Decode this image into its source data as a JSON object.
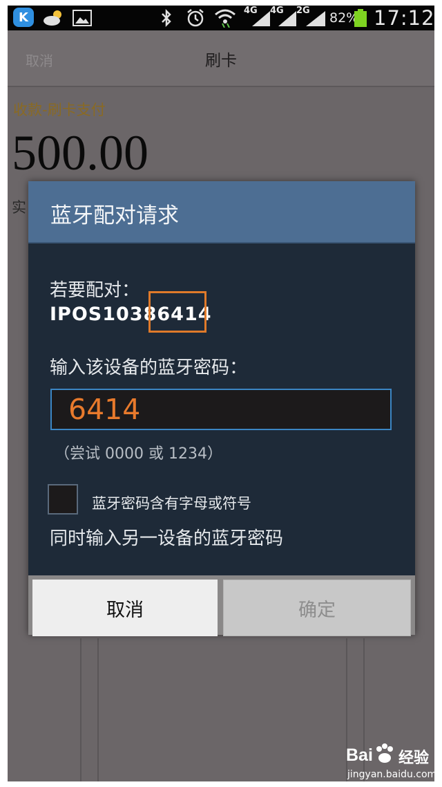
{
  "status_bar": {
    "app_icon_letter": "K",
    "net1": "4G",
    "net2": "4G",
    "net3": "2G",
    "battery_percent": "82%",
    "time": "17:12",
    "icons": [
      "app-k-icon",
      "weather-icon",
      "gallery-icon",
      "bluetooth-icon",
      "alarm-icon",
      "wifi-icon",
      "signal-4g-icon",
      "signal-4g-icon",
      "signal-2g-icon",
      "battery-icon"
    ]
  },
  "background_app": {
    "cancel_label": "取消",
    "title": "刷卡",
    "subtitle": "收款-刷卡支付",
    "amount": "500.00",
    "fragment": "实"
  },
  "dialog": {
    "title": "蓝牙配对请求",
    "pair_label": "若要配对：",
    "device_name": "IPOS10386414",
    "pin_label": "输入该设备的蓝牙密码：",
    "pin_value": "6414",
    "pin_hint": "（尝试 0000 或 1234）",
    "checkbox_label": "蓝牙密码含有字母或符号",
    "checkbox_checked": false,
    "simultaneous_label": "同时输入另一设备的蓝牙密码",
    "cancel_button": "取消",
    "ok_button": "确定",
    "colors": {
      "header": "#4d6e93",
      "body": "#1e2a38",
      "pin_text": "#e87a2c",
      "highlight": "#e07a2a"
    }
  },
  "watermark": {
    "logo": "Bai",
    "logo_cn": "经验",
    "url": "jingyan.baidu.com"
  }
}
